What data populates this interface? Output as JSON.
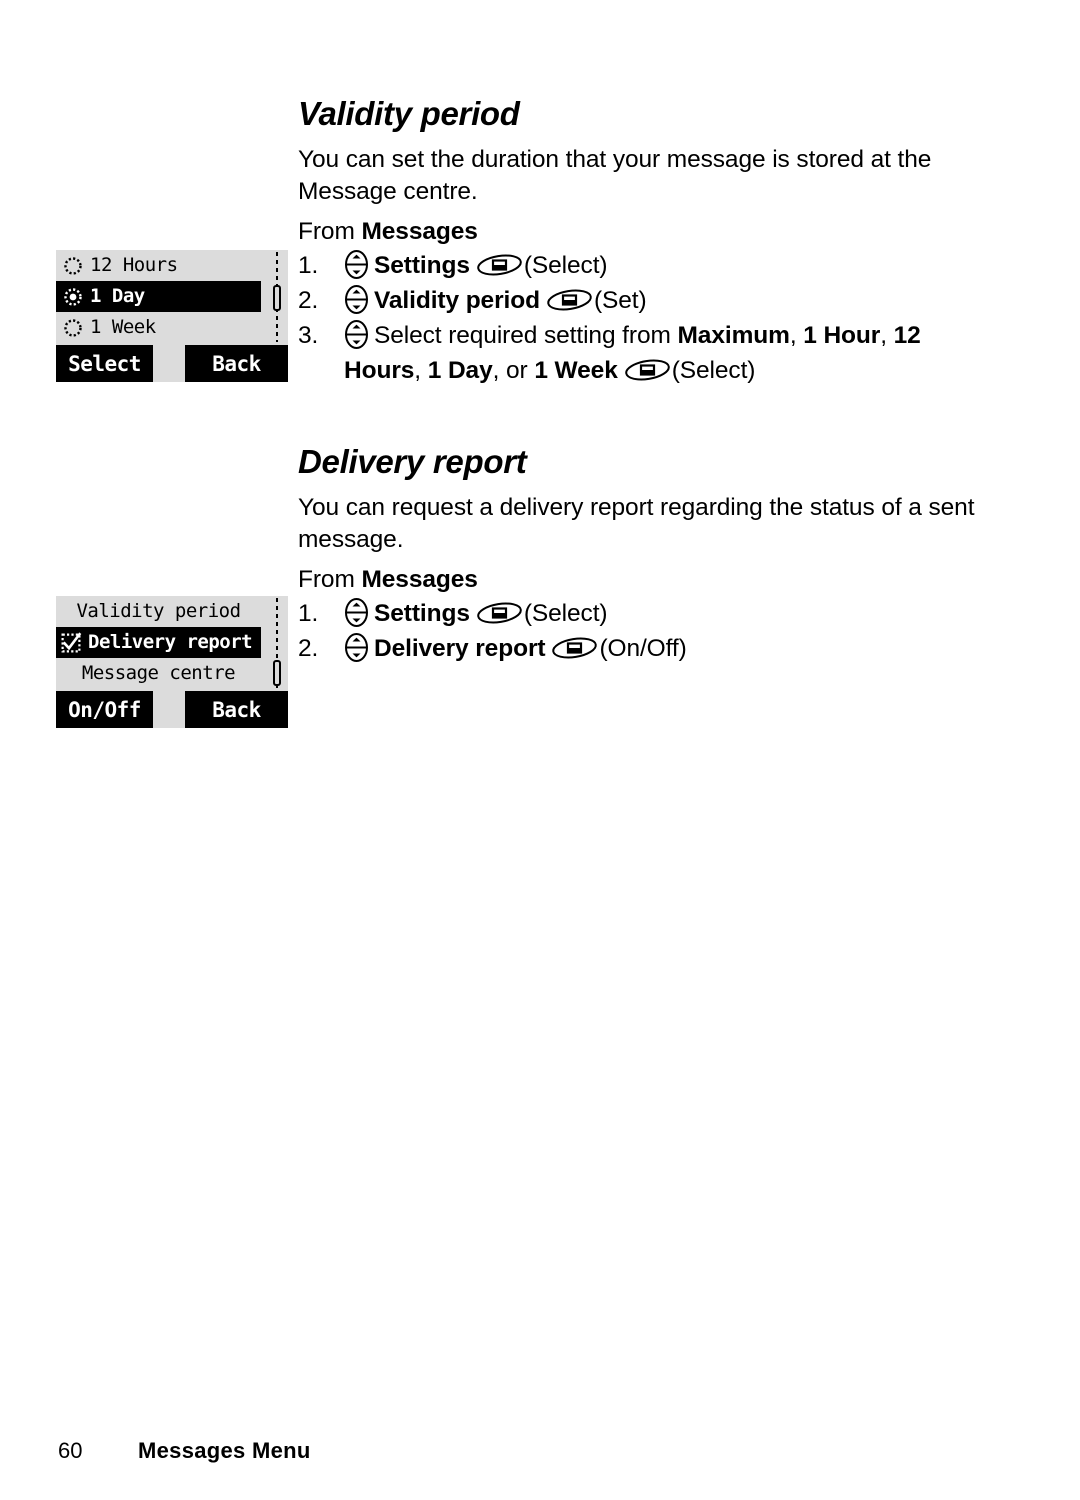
{
  "document": {
    "footer": {
      "page_number": "60",
      "title": "Messages Menu"
    }
  },
  "sections": [
    {
      "id": "validity",
      "heading": "Validity period",
      "intro": "You can set the duration that your message is stored at the Message centre.",
      "from_label": "From ",
      "from_target": "Messages",
      "steps": [
        {
          "num": "1.",
          "nav_icon": "nav-key-icon",
          "text_bold": "Settings",
          "sel_icon": "select-key-icon",
          "suffix": "(Select)"
        },
        {
          "num": "2.",
          "nav_icon": "nav-key-icon",
          "text_bold": "Validity period",
          "sel_icon": "select-key-icon",
          "suffix": "(Set)"
        },
        {
          "num": "3.",
          "nav_icon": "nav-key-icon",
          "text_plain_1": "Select required setting from ",
          "b1": "Maximum",
          "sep1": ", ",
          "b2": "1 Hour",
          "sep2": ", ",
          "b3": "12 Hours",
          "sep3": ", ",
          "b4": "1 Day",
          "sep4": ", or ",
          "b5": "1 Week",
          "sel_icon": "select-key-icon",
          "suffix": "(Select)"
        }
      ]
    },
    {
      "id": "delivery",
      "heading": "Delivery report",
      "intro": "You can request a delivery report regarding the status of a sent message.",
      "from_label": "From ",
      "from_target": "Messages",
      "steps": [
        {
          "num": "1.",
          "nav_icon": "nav-key-icon",
          "text_bold": "Settings",
          "sel_icon": "select-key-icon",
          "suffix": "(Select)"
        },
        {
          "num": "2.",
          "nav_icon": "nav-key-icon",
          "text_bold": "Delivery report",
          "sel_icon": "select-key-icon",
          "suffix": "(On/Off)"
        }
      ]
    }
  ],
  "screens": [
    {
      "id": "validity",
      "style": "radio-list",
      "rows": [
        {
          "mark": "radio-unchecked-icon",
          "label": "12 Hours",
          "selected": false
        },
        {
          "mark": "radio-checked-icon",
          "label": "1 Day",
          "selected": true
        },
        {
          "mark": "radio-unchecked-icon",
          "label": "1 Week",
          "selected": false
        }
      ],
      "scrollbar": {
        "thumb_position": "middle"
      },
      "softkeys": {
        "left": "Select",
        "right": "Back"
      }
    },
    {
      "id": "delivery",
      "style": "menu-list",
      "rows": [
        {
          "mark": "none",
          "label": "Validity period",
          "selected": false
        },
        {
          "mark": "checkbox-checked-icon",
          "label": "Delivery report",
          "selected": true
        },
        {
          "mark": "none",
          "label": "Message centre",
          "selected": false
        }
      ],
      "scrollbar": {
        "thumb_position": "bottom"
      },
      "softkeys": {
        "left": "On/Off",
        "right": "Back"
      }
    }
  ],
  "colors": {
    "lcd_background": "#dcdcdc",
    "lcd_foreground": "#000000",
    "highlight_background": "#000000",
    "highlight_foreground": "#ffffff",
    "page_background": "#ffffff"
  }
}
